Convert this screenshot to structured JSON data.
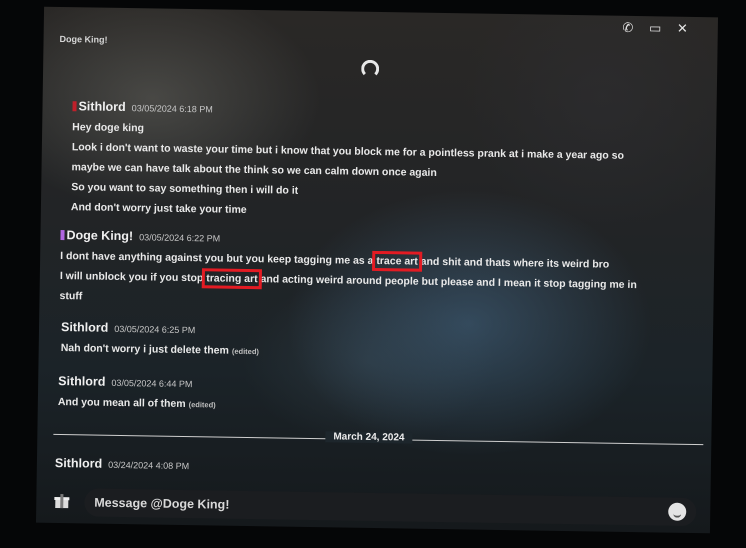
{
  "header": {
    "channel_name": "Doge King!",
    "icons": [
      "phone-icon",
      "video-icon",
      "close-icon"
    ]
  },
  "messages": [
    {
      "author": "Sithlord",
      "timestamp": "03/05/2024 6:18 PM",
      "lines": [
        "Hey doge king",
        "Look i don't want to waste your time but i know that you block me for a pointless prank at i make a year ago so",
        "maybe we can have talk about the think so we can calm down once again",
        "So you want to say something then i will do it",
        "And don't worry just take your time"
      ]
    },
    {
      "author": "Doge King!",
      "timestamp": "03/05/2024 6:22 PM",
      "line1_pre": "I dont have anything against you but you keep tagging me as a ",
      "line1_hl": "trace art",
      "line1_post": " and shit and thats where its weird bro",
      "line2_pre": "I will unblock you if you stop ",
      "line2_hl": "tracing art",
      "line2_post": " and acting weird around people but please and I mean it stop tagging me in",
      "line3": "stuff"
    },
    {
      "author": "Sithlord",
      "timestamp": "03/05/2024 6:25 PM",
      "text": "Nah don't worry i just delete them",
      "edited": "(edited)"
    },
    {
      "author": "Sithlord",
      "timestamp": "03/05/2024 6:44 PM",
      "text": "And you mean all of them",
      "edited": "(edited)"
    },
    {
      "author": "Sithlord",
      "timestamp": "03/24/2024 4:08 PM"
    }
  ],
  "date_divider": "March 24, 2024",
  "composer": {
    "placeholder": "Message @Doge King!"
  },
  "colors": {
    "highlight_box": "#e31b23",
    "background": "#1d262c"
  }
}
